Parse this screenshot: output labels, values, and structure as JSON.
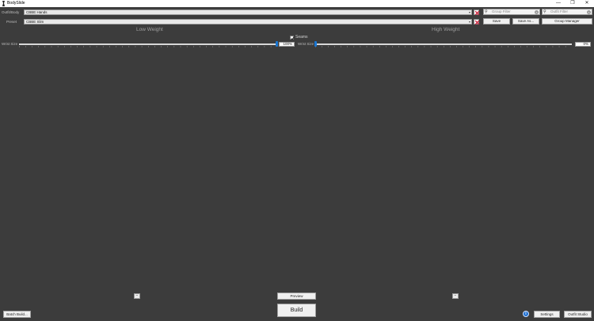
{
  "window": {
    "title": "BodySlide",
    "minimize": "—",
    "maximize": "❐",
    "close": "✕"
  },
  "outfit": {
    "label": "Outfit/Body",
    "value": "CBBE Hands"
  },
  "preset": {
    "label": "Preset",
    "value": "CBBE Slim"
  },
  "filters": {
    "group_placeholder": "Group Filter",
    "outfit_placeholder": "Outfit Filter"
  },
  "buttons": {
    "save": "Save",
    "save_as": "Save As...",
    "group_manager": "Group Manager",
    "preview": "Preview",
    "build": "Build",
    "batch_build": "Batch Build...",
    "settings": "Settings",
    "outfit_studio": "Outfit Studio"
  },
  "headers": {
    "low": "Low Weight",
    "high": "High Weight"
  },
  "seams": {
    "label": "Seams",
    "checked": true
  },
  "sliders": {
    "low": {
      "name": "Wrist Size",
      "value": "100%",
      "fraction": 1.0
    },
    "high": {
      "name": "Wrist Size",
      "value": "0%",
      "fraction": 0.0
    }
  },
  "icons": {
    "search": "search-icon",
    "clear": "clear-icon",
    "remove": "close-icon",
    "info": "info-icon",
    "app": "app-icon"
  },
  "colors": {
    "background": "#3c3c3c",
    "slider_handle": "#1976d2",
    "remove_x": "#d11f3a",
    "info": "#1e6fd0"
  }
}
